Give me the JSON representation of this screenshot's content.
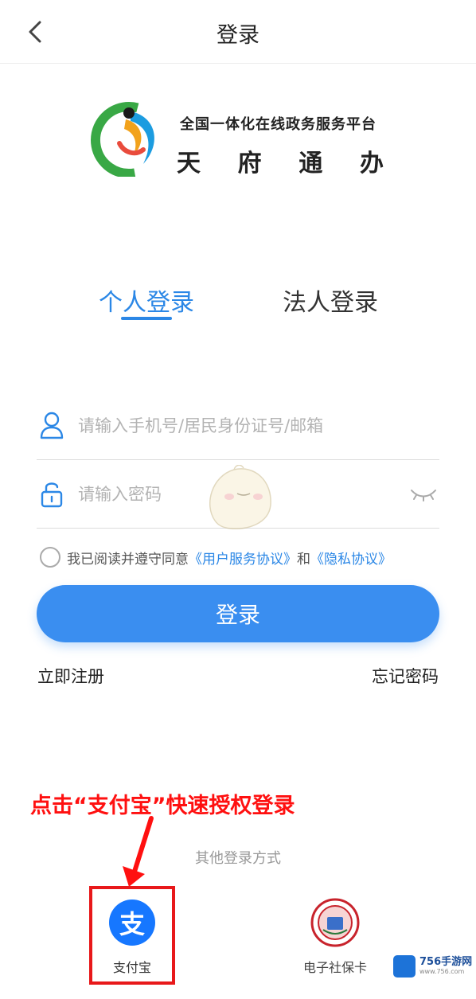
{
  "header": {
    "title": "登录"
  },
  "brand": {
    "line1": "全国一体化在线政务服务平台",
    "line2_chars": [
      "天",
      "府",
      "通",
      "办"
    ]
  },
  "tabs": [
    {
      "label": "个人登录",
      "active": true
    },
    {
      "label": "法人登录",
      "active": false
    }
  ],
  "form": {
    "account_placeholder": "请输入手机号/居民身份证号/邮箱",
    "password_placeholder": "请输入密码"
  },
  "agreement": {
    "prefix": "我已阅读并遵守同意",
    "user_agreement": "《用户服务协议》",
    "conjunction": "和",
    "privacy": "《隐私协议》",
    "checked": false
  },
  "login_button": "登录",
  "register_link": "立即注册",
  "forgot_link": "忘记密码",
  "annotation": "点击“支付宝”快速授权登录",
  "other_login": {
    "title": "其他登录方式",
    "methods": [
      {
        "label": "支付宝",
        "icon": "alipay-icon",
        "icon_char": "支"
      },
      {
        "label": "电子社保卡",
        "icon": "social-security-card-icon"
      }
    ]
  },
  "watermark": {
    "name": "756手游网",
    "url": "www.756.com"
  },
  "colors": {
    "primary": "#3a8ef0",
    "tab_active": "#2b87e6",
    "annotation": "#ff1010",
    "alipay": "#1677ff"
  }
}
